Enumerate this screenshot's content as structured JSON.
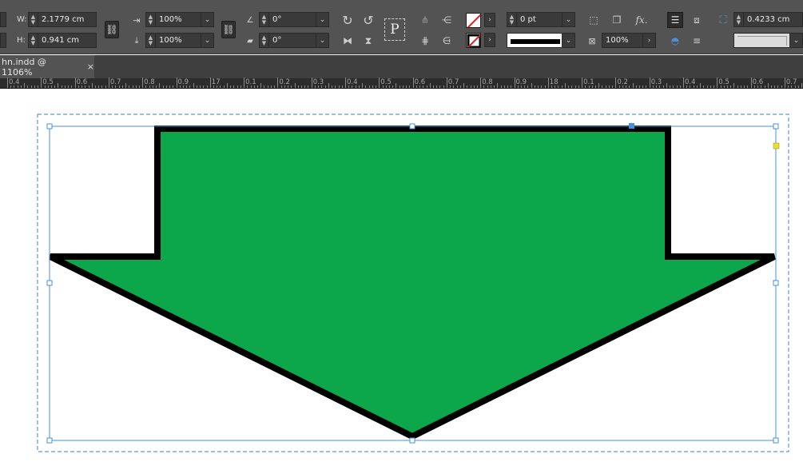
{
  "control_bar": {
    "w_label": "W:",
    "w_value": "2.1779 cm",
    "h_label": "H:",
    "h_value": "0.941 cm",
    "scale_x": "100%",
    "scale_y": "100%",
    "rotation": "0°",
    "shear": "0°",
    "stroke_weight": "0 pt",
    "opacity": "100%",
    "corner_size": "0.4233 cm",
    "text_p_icon": "P",
    "fx_label": "fx."
  },
  "tabs": [
    {
      "label": "hn.indd @ 1106%",
      "close": "×"
    }
  ],
  "ruler": {
    "labels": [
      "0.4",
      "0.5",
      "0.6",
      "0.7",
      "0.8",
      "0.9",
      "17",
      "0.1",
      "0.2",
      "0.3",
      "0.4",
      "0.5",
      "0.6",
      "0.7",
      "0.8",
      "0.9",
      "18",
      "0.1",
      "0.2",
      "0.3",
      "0.4",
      "0.5",
      "0.6",
      "0.7"
    ]
  },
  "canvas": {
    "shape": "down-arrow",
    "fill_color": "#0ca64b",
    "stroke_color": "#000000",
    "selection_color": "#4a90d9",
    "frame_color": "#5c9bd9",
    "handle_accent": "#4a90d9",
    "corner_handle_color": "#e8e22a"
  },
  "colors": {
    "panel_bg": "#535353",
    "tab_bg": "#3f3f3f",
    "ruler_bg": "#2c2c2c"
  }
}
